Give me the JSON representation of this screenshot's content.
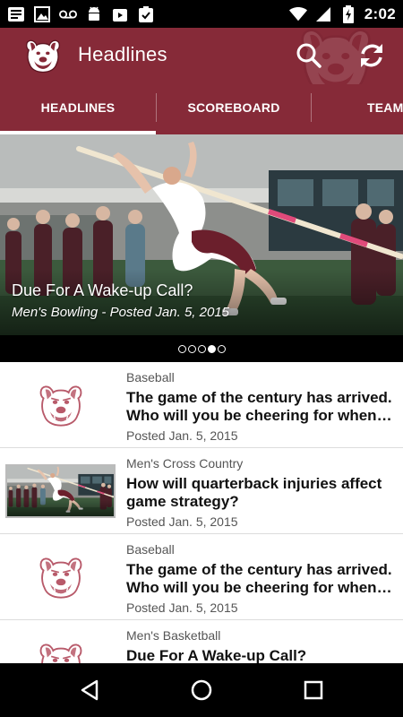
{
  "status_bar": {
    "time": "2:02",
    "left_icons": [
      "sim-card-icon",
      "image-icon",
      "voicemail-icon",
      "android-icon",
      "play-store-icon",
      "clipboard-check-icon"
    ],
    "right_icons": [
      "wifi-icon",
      "signal-icon",
      "battery-charging-icon"
    ]
  },
  "app_bar": {
    "title": "Headlines",
    "logo": "bulldog-logo-icon",
    "actions": [
      "search-icon",
      "refresh-icon"
    ],
    "colors": {
      "primary": "#862a38"
    }
  },
  "tabs": [
    {
      "label": "HEADLINES",
      "selected": true
    },
    {
      "label": "SCOREBOARD",
      "selected": false
    },
    {
      "label": "TEAM",
      "selected": false
    }
  ],
  "featured": {
    "title": "Due For A Wake-up Call?",
    "subtitle": "Men's Bowling - Posted Jan. 5, 2015",
    "image": "pole-vault-photo",
    "pager": {
      "count": 5,
      "active_index": 3
    }
  },
  "news": [
    {
      "category": "Baseball",
      "headline": "The game of the century has arrived. Who will you be cheering for when the game starts?",
      "date": "Posted Jan. 5, 2015",
      "thumbnail": "bulldog-logo-icon"
    },
    {
      "category": "Men's Cross Country",
      "headline": "How will quarterback injuries affect game strategy?",
      "date": "Posted Jan. 5, 2015",
      "thumbnail": "pole-vault-photo"
    },
    {
      "category": "Baseball",
      "headline": "The game of the century has arrived. Who will you be cheering for when the game starts?",
      "date": "Posted Jan. 5, 2015",
      "thumbnail": "bulldog-logo-icon"
    },
    {
      "category": "Men's Basketball",
      "headline": "Due For A Wake-up Call?",
      "date": "",
      "thumbnail": "bulldog-logo-icon"
    }
  ],
  "nav_bar": {
    "buttons": [
      "back-icon",
      "home-icon",
      "recents-icon"
    ]
  }
}
